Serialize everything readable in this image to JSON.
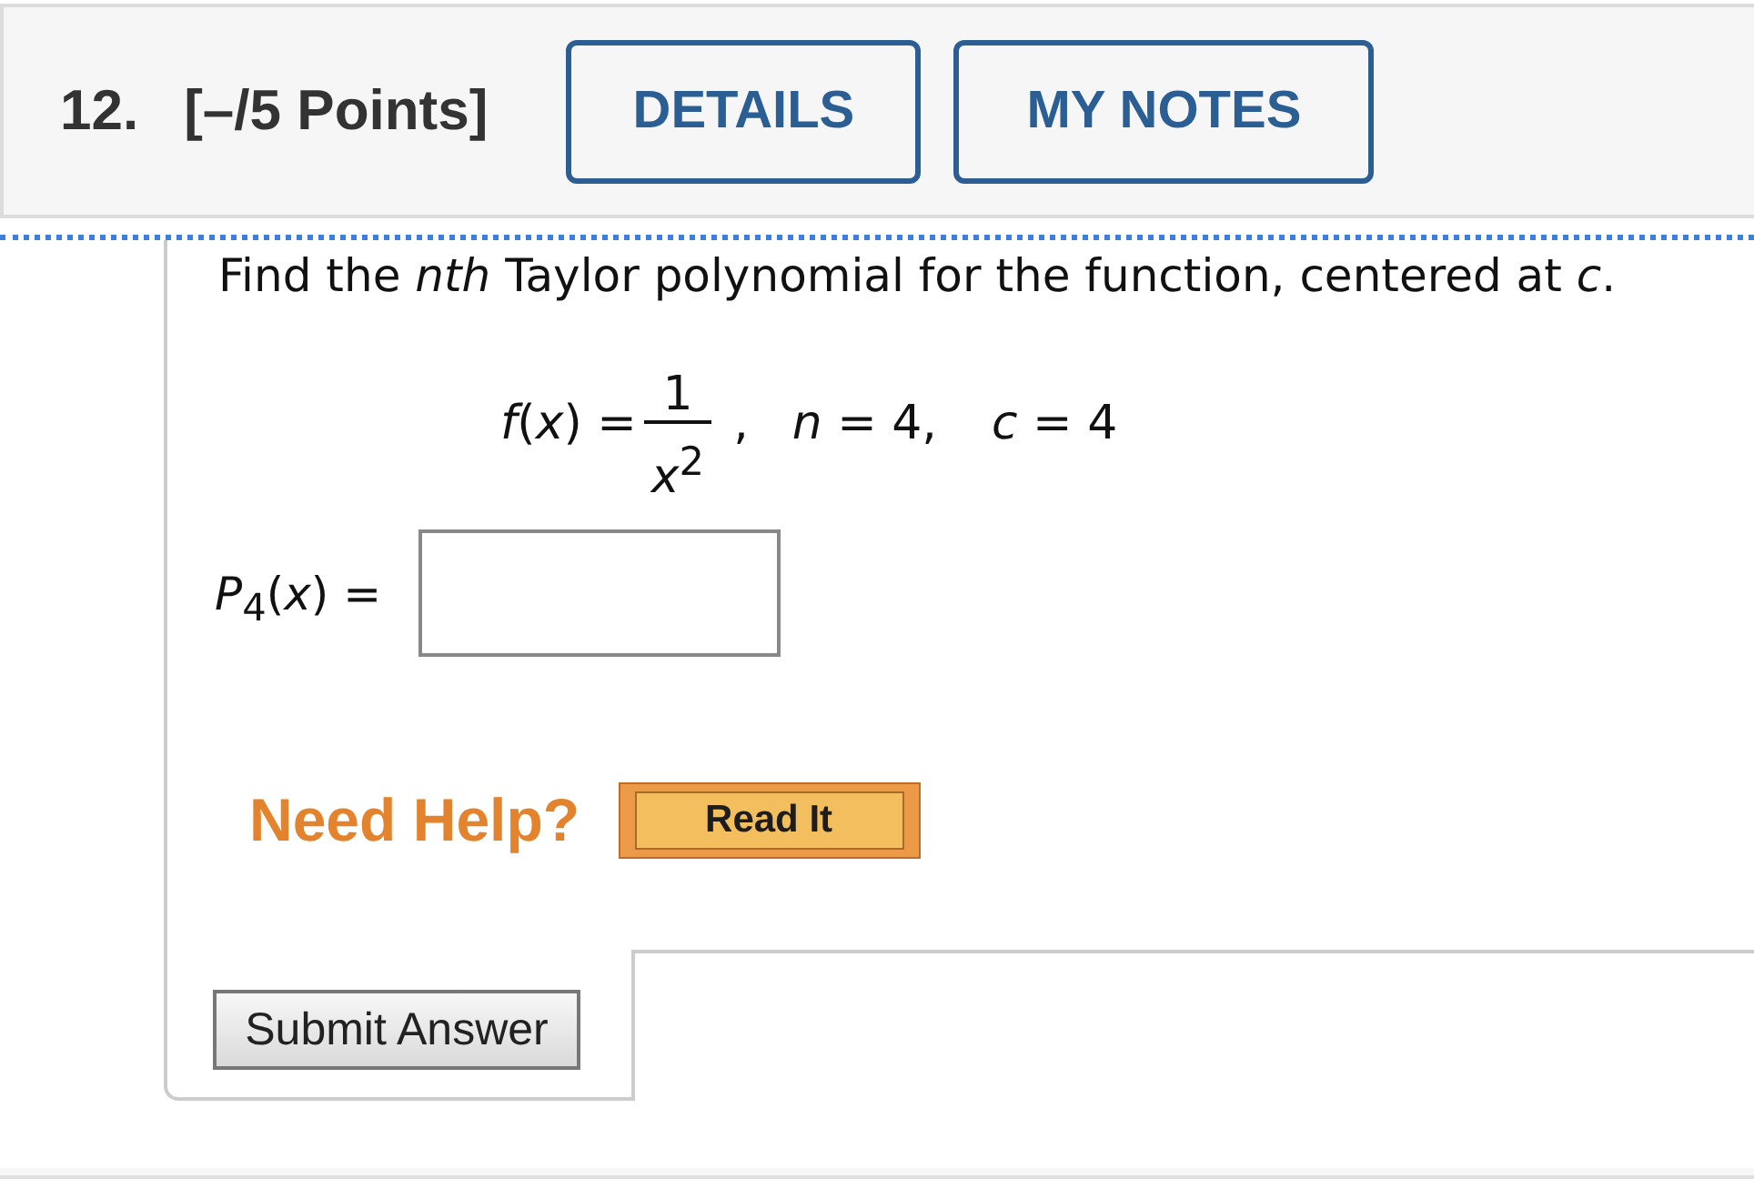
{
  "header": {
    "number": "12.",
    "points": "[–/5 Points]",
    "buttons": [
      "DETAILS",
      "MY NOTES"
    ]
  },
  "prompt": "Find the *nth* Taylor polynomial for the function, centered at *c*.",
  "formula": {
    "lhs": "*f*(*x*) =",
    "numerator": "1",
    "denominator": "*x*$^{2}$",
    "separator": ",",
    "params": [
      "*n* = 4,",
      "*c* = 4"
    ]
  },
  "answer": {
    "label": "*P*$_{4}$(*x*) ="
  },
  "help": {
    "label": "Need Help?",
    "buttons": [
      "Read It"
    ]
  },
  "submit": {
    "label": "Submit Answer"
  }
}
